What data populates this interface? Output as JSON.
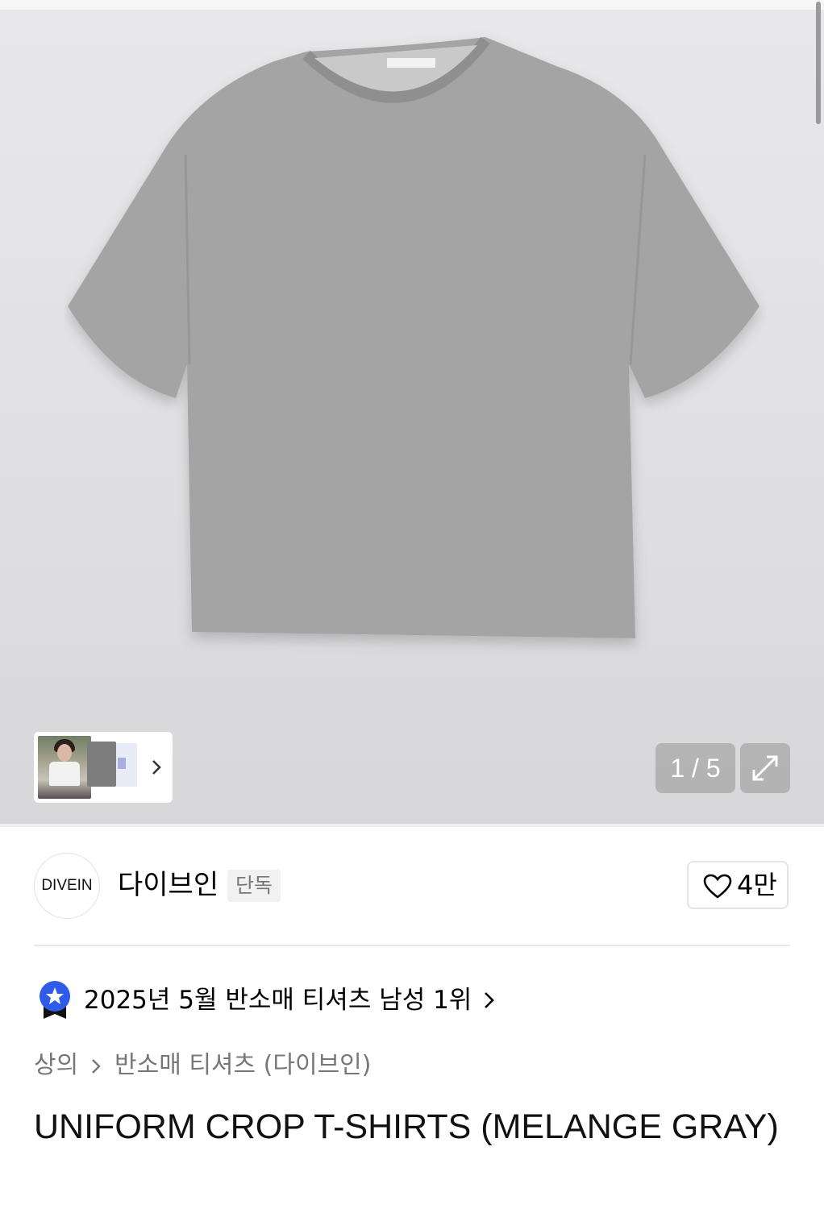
{
  "gallery": {
    "counter": "1 / 5",
    "product_image": "gray-crop-tshirt",
    "thumbnails": [
      "model-photo",
      "gray-tshirt",
      "white-tshirt"
    ]
  },
  "brand": {
    "logo_text": "DIVEIN",
    "name": "다이브인",
    "tag": "단독",
    "like_count": "4만"
  },
  "ranking": {
    "text": "2025년 5월 반소매 티셔츠 남성 1위"
  },
  "breadcrumb": {
    "items": [
      "상의",
      "반소매 티셔츠 (다이브인)"
    ]
  },
  "product": {
    "title": "UNIFORM CROP T-SHIRTS (MELANGE GRAY)"
  },
  "colors": {
    "accent_blue": "#2f5bea",
    "text_muted": "#777777"
  }
}
